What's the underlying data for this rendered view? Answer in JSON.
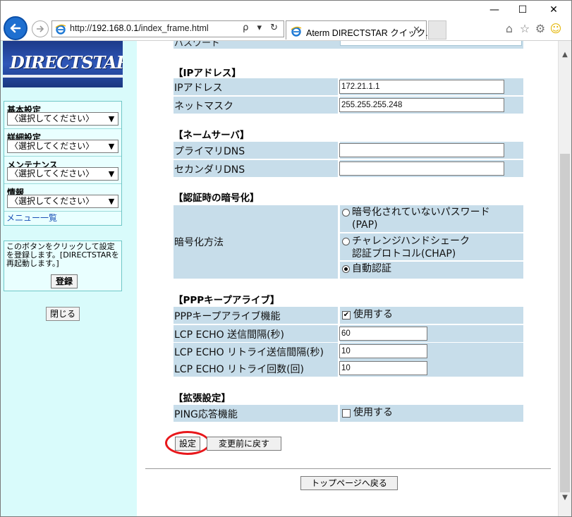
{
  "browser": {
    "url_prefix": "http://",
    "url_host": "192.168.0.1",
    "url_path": "/index_frame.html",
    "tab_title": "Aterm DIRECTSTAR クイック...",
    "addr_tools": "ρ ▾ ↻",
    "window_buttons": {
      "minimize": "—",
      "maximize": "☐",
      "close": "✕"
    }
  },
  "left": {
    "logo_text": "DIRECTSTAR",
    "menu": [
      {
        "label": "基本設定",
        "selected": "〈選択してください〉"
      },
      {
        "label": "詳細設定",
        "selected": "〈選択してください〉"
      },
      {
        "label": "メンテナンス",
        "selected": "〈選択してください〉"
      },
      {
        "label": "情報",
        "selected": "〈選択してください〉"
      }
    ],
    "menu_list_link": "メニュー一覧",
    "register_text": "このボタンをクリックして設定を登録します。[DIRECTSTARを再起動します。]",
    "register_button": "登録",
    "close_button": "閉じる"
  },
  "main": {
    "top_partial_label": "パスワード",
    "ip_section": {
      "title": "【IPアドレス】",
      "ip_label": "IPアドレス",
      "ip_value": "172.21.1.1",
      "mask_label": "ネットマスク",
      "mask_value": "255.255.255.248"
    },
    "dns_section": {
      "title": "【ネームサーバ】",
      "primary_label": "プライマリDNS",
      "primary_value": "",
      "secondary_label": "セカンダリDNS",
      "secondary_value": ""
    },
    "auth_section": {
      "title": "【認証時の暗号化】",
      "method_label": "暗号化方法",
      "options": [
        {
          "line1": "暗号化されていないパスワード",
          "line2": "(PAP)",
          "checked": false
        },
        {
          "line1": "チャレンジハンドシェーク",
          "line2": "認証プロトコル(CHAP)",
          "checked": false
        },
        {
          "line1": "自動認証",
          "line2": "",
          "checked": true
        }
      ]
    },
    "keepalive_section": {
      "title": "【PPPキープアライブ】",
      "func_label": "PPPキープアライブ機能",
      "func_option": "使用する",
      "func_checked": true,
      "interval_label": "LCP ECHO 送信間隔(秒)",
      "interval_value": "60",
      "retry_interval_label": "LCP ECHO リトライ送信間隔(秒)",
      "retry_interval_value": "10",
      "retry_count_label": "LCP ECHO リトライ回数(回)",
      "retry_count_value": "10"
    },
    "ext_section": {
      "title": "【拡張設定】",
      "ping_label": "PING応答機能",
      "ping_option": "使用する",
      "ping_checked": false
    },
    "set_button": "設定",
    "revert_button": "変更前に戻す",
    "top_page_button": "トップページへ戻る"
  }
}
